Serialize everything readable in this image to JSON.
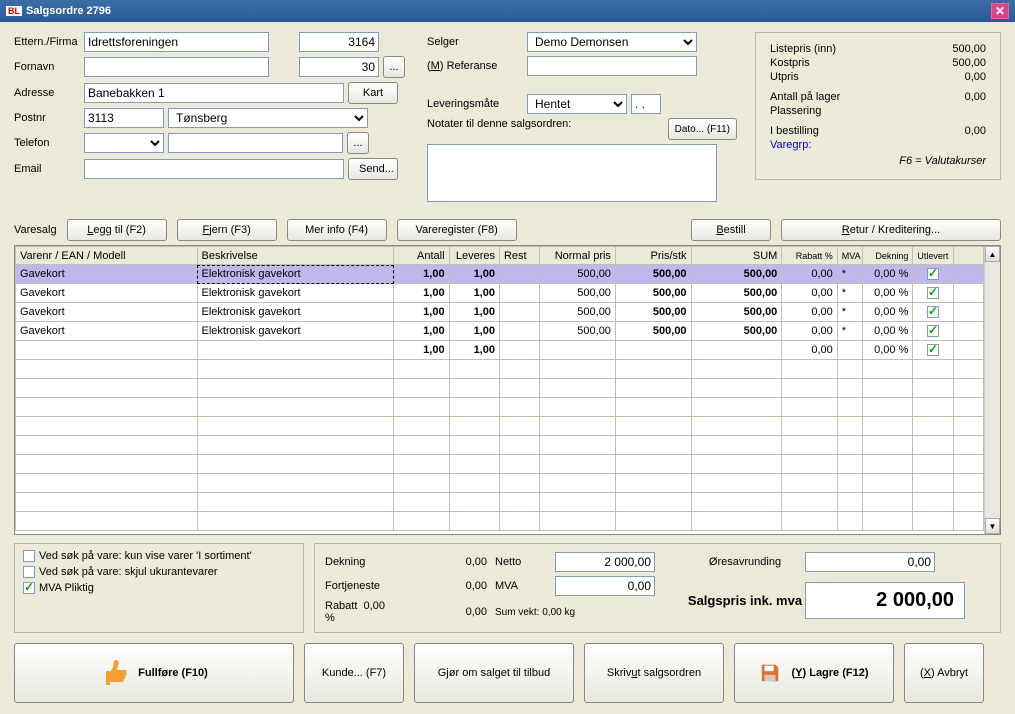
{
  "title": "Salgsordre 2796",
  "labels": {
    "ettern": "Ettern./Firma",
    "fornavn": "Fornavn",
    "adresse": "Adresse",
    "postnr": "Postnr",
    "telefon": "Telefon",
    "email": "Email",
    "kart": "Kart",
    "send": "Send...",
    "selger": "Selger",
    "referanse_pre": "(",
    "referanse_u": "M",
    "referanse_post": ") Referanse",
    "leveringsmate": "Leveringsmåte",
    "notater": "Notater til denne salgsordren:",
    "dato": "Dato... (F11)",
    "varesalg": "Varesalg",
    "leggtil_pre": "",
    "leggtil_u": "L",
    "leggtil_post": "egg til (F2)",
    "fjern_u": "F",
    "fjern_post": "jern (F3)",
    "merinfo": "Mer info (F4)",
    "varereg": "Vareregister (F8)",
    "bestill_u": "B",
    "bestill_post": "estill",
    "retur_u": "R",
    "retur_post": "etur / Kreditering...",
    "fullfore": "Fullføre (F10)",
    "kunde": "Kunde... (F7)",
    "gjorom": "Gjør om salget til tilbud",
    "skrivut_pre": "Skriv ",
    "skrivut_u": "u",
    "skrivut_post": "t salgsordren",
    "lagre_pre": "(",
    "lagre_u": "Y",
    "lagre_post": ") Lagre (F12)",
    "avbryt_pre": "(",
    "avbryt_u": "X",
    "avbryt_post": ") Avbryt",
    "ellipsis": "..."
  },
  "customer": {
    "ettern": "Idrettsforeningen",
    "ettern_num": "3164",
    "fornavn": "",
    "fornavn_num": "30",
    "adresse": "Banebakken 1",
    "postnr": "3113",
    "poststed": "Tønsberg",
    "telefon": "",
    "telefon2": "",
    "email": ""
  },
  "sale": {
    "selger": "Demo Demonsen",
    "referanse": "",
    "leveringsmate": "Hentet",
    "lev_extra": ". .",
    "notater": ""
  },
  "info": {
    "listepris_lbl": "Listepris (inn)",
    "listepris": "500,00",
    "kostpris_lbl": "Kostpris",
    "kostpris": "500,00",
    "utpris_lbl": "Utpris",
    "utpris": "0,00",
    "antall_lbl": "Antall på lager",
    "antall": "0,00",
    "plassering_lbl": "Plassering",
    "plassering": "",
    "ibest_lbl": "I bestilling",
    "ibest": "0,00",
    "varegrp_lbl": "Varegrp:",
    "f6_lbl": "F6 = Valutakurser"
  },
  "gridHeaders": {
    "varenr": "Varenr / EAN / Modell",
    "beskr": "Beskrivelse",
    "antall": "Antall",
    "leveres": "Leveres",
    "rest": "Rest",
    "normal": "Normal pris",
    "prisstk": "Pris/stk",
    "sum": "SUM",
    "rabatt": "Rabatt %",
    "mva": "MVA",
    "dekning": "Dekning",
    "utlevert": "Utlevert"
  },
  "rows": [
    {
      "varenr": "Gavekort",
      "beskr": "Elektronisk gavekort",
      "antall": "1,00",
      "leveres": "1,00",
      "rest": "",
      "normal": "500,00",
      "prisstk": "500,00",
      "sum": "500,00",
      "rabatt": "0,00",
      "mva": "*",
      "dekning": "0,00 %",
      "utlevert": true,
      "sel": true
    },
    {
      "varenr": "Gavekort",
      "beskr": "Elektronisk gavekort",
      "antall": "1,00",
      "leveres": "1,00",
      "rest": "",
      "normal": "500,00",
      "prisstk": "500,00",
      "sum": "500,00",
      "rabatt": "0,00",
      "mva": "*",
      "dekning": "0,00 %",
      "utlevert": true
    },
    {
      "varenr": "Gavekort",
      "beskr": "Elektronisk gavekort",
      "antall": "1,00",
      "leveres": "1,00",
      "rest": "",
      "normal": "500,00",
      "prisstk": "500,00",
      "sum": "500,00",
      "rabatt": "0,00",
      "mva": "*",
      "dekning": "0,00 %",
      "utlevert": true
    },
    {
      "varenr": "Gavekort",
      "beskr": "Elektronisk gavekort",
      "antall": "1,00",
      "leveres": "1,00",
      "rest": "",
      "normal": "500,00",
      "prisstk": "500,00",
      "sum": "500,00",
      "rabatt": "0,00",
      "mva": "*",
      "dekning": "0,00 %",
      "utlevert": true
    },
    {
      "varenr": "",
      "beskr": "",
      "antall": "1,00",
      "leveres": "1,00",
      "rest": "",
      "normal": "",
      "prisstk": "",
      "sum": "",
      "rabatt": "0,00",
      "mva": "",
      "dekning": "0,00 %",
      "utlevert": true
    }
  ],
  "options": {
    "opt1": "Ved søk på vare: kun vise varer 'I sortiment'",
    "opt2": "Ved søk på vare: skjul ukurantevarer",
    "opt3": "MVA Pliktig",
    "opt1_on": false,
    "opt2_on": false,
    "opt3_on": true
  },
  "totals": {
    "dekning_lbl": "Dekning",
    "dekning": "0,00",
    "fortj_lbl": "Fortjeneste",
    "fortj": "0,00",
    "rabatt_lbl": "Rabatt",
    "rabatt_pct": "0,00 %",
    "rabatt": "0,00",
    "netto_lbl": "Netto",
    "netto": "2 000,00",
    "mva_lbl": "MVA",
    "mva": "0,00",
    "sumvekt_lbl": "Sum vekt: 0,00 kg",
    "ores_lbl": "Øresavrunding",
    "ores": "0,00",
    "salgspris_lbl": "Salgspris ink. mva",
    "salgspris": "2 000,00"
  }
}
